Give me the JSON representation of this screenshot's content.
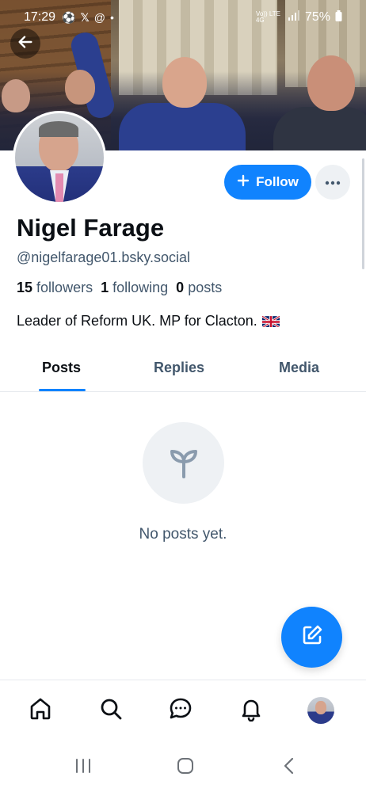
{
  "status_bar": {
    "time": "17:29",
    "network": "Vo)) LTE 4G",
    "battery": "75%"
  },
  "profile": {
    "name": "Nigel Farage",
    "handle": "@nigelfarage01.bsky.social",
    "followers_count": "15",
    "followers_label": "followers",
    "following_count": "1",
    "following_label": "following",
    "posts_count": "0",
    "posts_label": "posts",
    "bio": "Leader of Reform UK. MP for Clacton."
  },
  "actions": {
    "follow_label": "Follow"
  },
  "tabs": [
    {
      "label": "Posts",
      "active": true
    },
    {
      "label": "Replies",
      "active": false
    },
    {
      "label": "Media",
      "active": false
    }
  ],
  "empty_state": {
    "message": "No posts yet.",
    "icon": "sprout-icon"
  },
  "bottom_nav": {
    "items": [
      "home-icon",
      "search-icon",
      "chat-icon",
      "bell-icon",
      "avatar"
    ]
  },
  "colors": {
    "accent": "#1083fe",
    "text_primary": "#0b0f14",
    "text_secondary": "#42576c",
    "surface_muted": "#eef1f4"
  }
}
